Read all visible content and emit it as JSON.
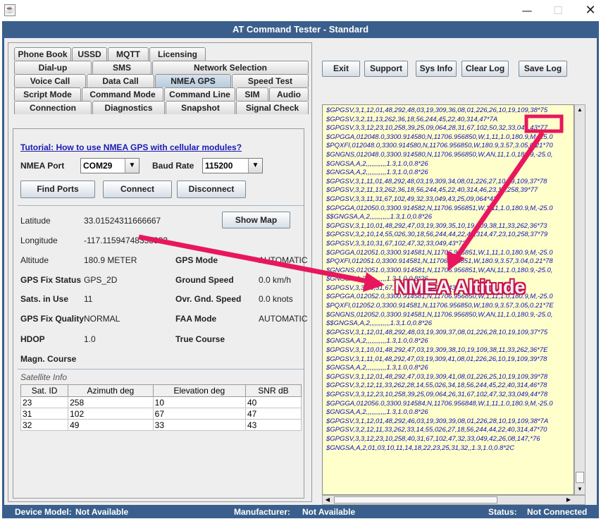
{
  "window": {
    "title": "AT Command Tester - Standard",
    "controls": {
      "minimize": "—",
      "maximize": "☐",
      "close": "✕"
    }
  },
  "tabs": {
    "row1": [
      "Phone Book",
      "USSD",
      "MQTT",
      "Licensing"
    ],
    "row2": [
      "Dial-up",
      "SMS",
      "Network Selection"
    ],
    "row3": [
      "Voice Call",
      "Data Call",
      "NMEA GPS",
      "Speed Test"
    ],
    "row4": [
      "Script Mode",
      "Command Mode",
      "Command Line",
      "SIM",
      "Audio"
    ],
    "row5": [
      "Connection",
      "Diagnostics",
      "Snapshot",
      "Signal Check"
    ],
    "active": "NMEA GPS"
  },
  "gps": {
    "tutorial_link": "Tutorial: How to use NMEA GPS with cellular modules?",
    "nmea_port_label": "NMEA Port",
    "nmea_port_value": "COM29",
    "baud_rate_label": "Baud Rate",
    "baud_rate_value": "115200",
    "find_ports": "Find Ports",
    "connect": "Connect",
    "disconnect": "Disconnect",
    "show_map": "Show Map",
    "latitude_label": "Latitude",
    "latitude_value": "33.01524311666667",
    "longitude_label": "Longitude",
    "longitude_value": "-117.11594748333333",
    "altitude_label": "Altitude",
    "altitude_value": "180.9 METER",
    "fix_status_label": "GPS Fix Status",
    "fix_status_value": "GPS_2D",
    "sats_label": "Sats. in Use",
    "sats_value": "11",
    "fix_quality_label": "GPS Fix Quality",
    "fix_quality_value": "NORMAL",
    "hdop_label": "HDOP",
    "hdop_value": "1.0",
    "magn_course_label": "Magn. Course",
    "gps_mode_label": "GPS Mode",
    "gps_mode_value": "AUTOMATIC",
    "ground_speed_label": "Ground Speed",
    "ground_speed_value": "0.0 km/h",
    "ovr_gnd_speed_label": "Ovr. Gnd. Speed",
    "ovr_gnd_speed_value": "0.0 knots",
    "faa_mode_label": "FAA Mode",
    "faa_mode_value": "AUTOMATIC",
    "true_course_label": "True Course",
    "satellite_info_label": "Satellite Info",
    "sat_columns": [
      "Sat. ID",
      "Azimuth deg",
      "Elevation deg",
      "SNR dB"
    ],
    "sat_rows": [
      [
        "23",
        "258",
        "10",
        "40"
      ],
      [
        "31",
        "102",
        "67",
        "47"
      ],
      [
        "32",
        "49",
        "33",
        "43"
      ]
    ]
  },
  "toolbar": {
    "exit": "Exit",
    "support": "Support",
    "sys_info": "Sys Info",
    "clear_log": "Clear Log",
    "save_log": "Save Log"
  },
  "log": [
    "$GPGSV,3,1,12,01,48,292,48,03,19,309,36,08,01,226,26,10,19,109,38*75",
    "$GPGSV,3,2,11,13,262,36,18,56,244,45,22,40,314,47*7A",
    "$GPGSV,3,3,12,23,10,258,39,25,09,064,28,31,67,102,50,32,33,049,43*77",
    "$GPGGA,012048.0,3300.914580,N,11706.956850,W,1,11,1.0,180.9,M,-25.0",
    "$PQXFI,012048.0,3300.914580,N,11706.956850,W,180.9,3.57,3.05,0.21*70",
    "$GNGNS,012048.0,3300.914580,N,11706.956850,W,AN,11,1.0,180.9,-25.0,",
    "$GNGSA,A,2,,,,,,,,,,,1.3,1.0,0.8*26",
    "$GNGSA,A,2,,,,,,,,,,,1.3,1.0,0.8*26",
    "$GPGSV,3,1,11,01,48,292,48,03,19,309,34,08,01,226,27,10,19,109,37*78",
    "$GPGSV,3,2,11,13,262,36,18,56,244,45,22,40,314,46,23,10,258,39*77",
    "$GPGSV,3,3,11,31,67,102,49,32,33,049,43,25,09,064*43",
    "$GPGGA,012050.0,3300.914582,N,11706.956851,W,1,11,1.0,180.9,M,-25.0",
    "$$GNGSA,A,2,,,,,,,,,,,1.3,1.0,0.8*26",
    "$GPGSV,3,1,10,01,48,292,47,03,19,309,35,10,19,109,38,11,33,262,36*73",
    "$GPGSV,3,2,10,14,55,026,30,18,56,244,44,22,40,314,47,23,10,258,37*79",
    "$GPGSV,3,3,10,31,67,102,47,32,33,049,43*72",
    "$GPGGA,012051.0,3300.914581,N,11706.956851,W,1,11,1.0,180.9,M,-25.0",
    "$PQXFI,012051.0,3300.914581,N,11706.956851,W,180.9,3.57,3.04,0.21*78",
    "$GNGNS,012051.0,3300.914581,N,11706.956851,W,AN,11,1.0,180.9,-25.0,",
    "$GNGSA,A,2,,,,,,,,,,,1.3,1.0,0.8*26",
    "$GPGSV,3,3,10,31,67,102,47,32,33,049,43*72",
    "$GPGGA,012052.0,3300.914581,N,11706.956850,W,1,11,1.0,180.9,M,-25.0",
    "$PQXFI,012052.0,3300.914581,N,11706.956850,W,180.9,3.57,3.05,0.21*7E",
    "$GNGNS,012052.0,3300.914581,N,11706.956850,W,AN,11,1.0,180.9,-25.0,",
    "$$GNGSA,A,2,,,,,,,,,,,1.3,1.0,0.8*26",
    "$GPGSV,3,1,12,01,48,292,48,03,19,309,37,08,01,226,28,10,19,109,37*75",
    "$GNGSA,A,2,,,,,,,,,,,1.3,1.0,0.8*26",
    "$GPGSV,3,1,10,01,48,292,47,03,19,309,38,10,19,109,38,11,33,262,36*7E",
    "$GPGSV,3,1,11,01,48,292,47,03,19,309,41,08,01,226,26,10,19,109,39*78",
    "$GNGSA,A,2,,,,,,,,,,,1.3,1.0,0.8*26",
    "$GPGSV,3,1,12,01,48,292,47,03,19,309,41,08,01,226,25,10,19,109,39*78",
    "$GPGSV,3,2,12,11,33,262,28,14,55,026,34,18,56,244,45,22,40,314,46*78",
    "$GPGSV,3,3,12,23,10,258,39,25,09,064,26,31,67,102,47,32,33,049,44*78",
    "$GPGGA,012056.0,3300.914584,N,11706.956848,W,1,11,1.0,180.9,M,-25.0",
    "$GNGSA,A,2,,,,,,,,,,,1.3,1.0,0.8*26",
    "$GPGSV,3,1,12,01,48,292,46,03,19,309,39,08,01,226,28,10,19,109,38*7A",
    "$GPGSV,3,2,12,11,33,262,33,14,55,026,27,18,56,244,44,22,40,314,47*70",
    "$GPGSV,3,3,12,23,10,258,40,31,67,102,47,32,33,049,42,26,08,147,*76",
    "$GNGSA,A,2,01,03,10,11,14,18,22,23,25,31,32,,1.3,1.0,0.8*2C"
  ],
  "annotation": {
    "text": "NMEA Altitude",
    "color": "#e8175d"
  },
  "status": {
    "device_model_label": "Device Model:",
    "device_model_value": "Not Available",
    "manufacturer_label": "Manufacturer:",
    "manufacturer_value": "Not Available",
    "status_label": "Status:",
    "status_value": "Not Connected"
  }
}
